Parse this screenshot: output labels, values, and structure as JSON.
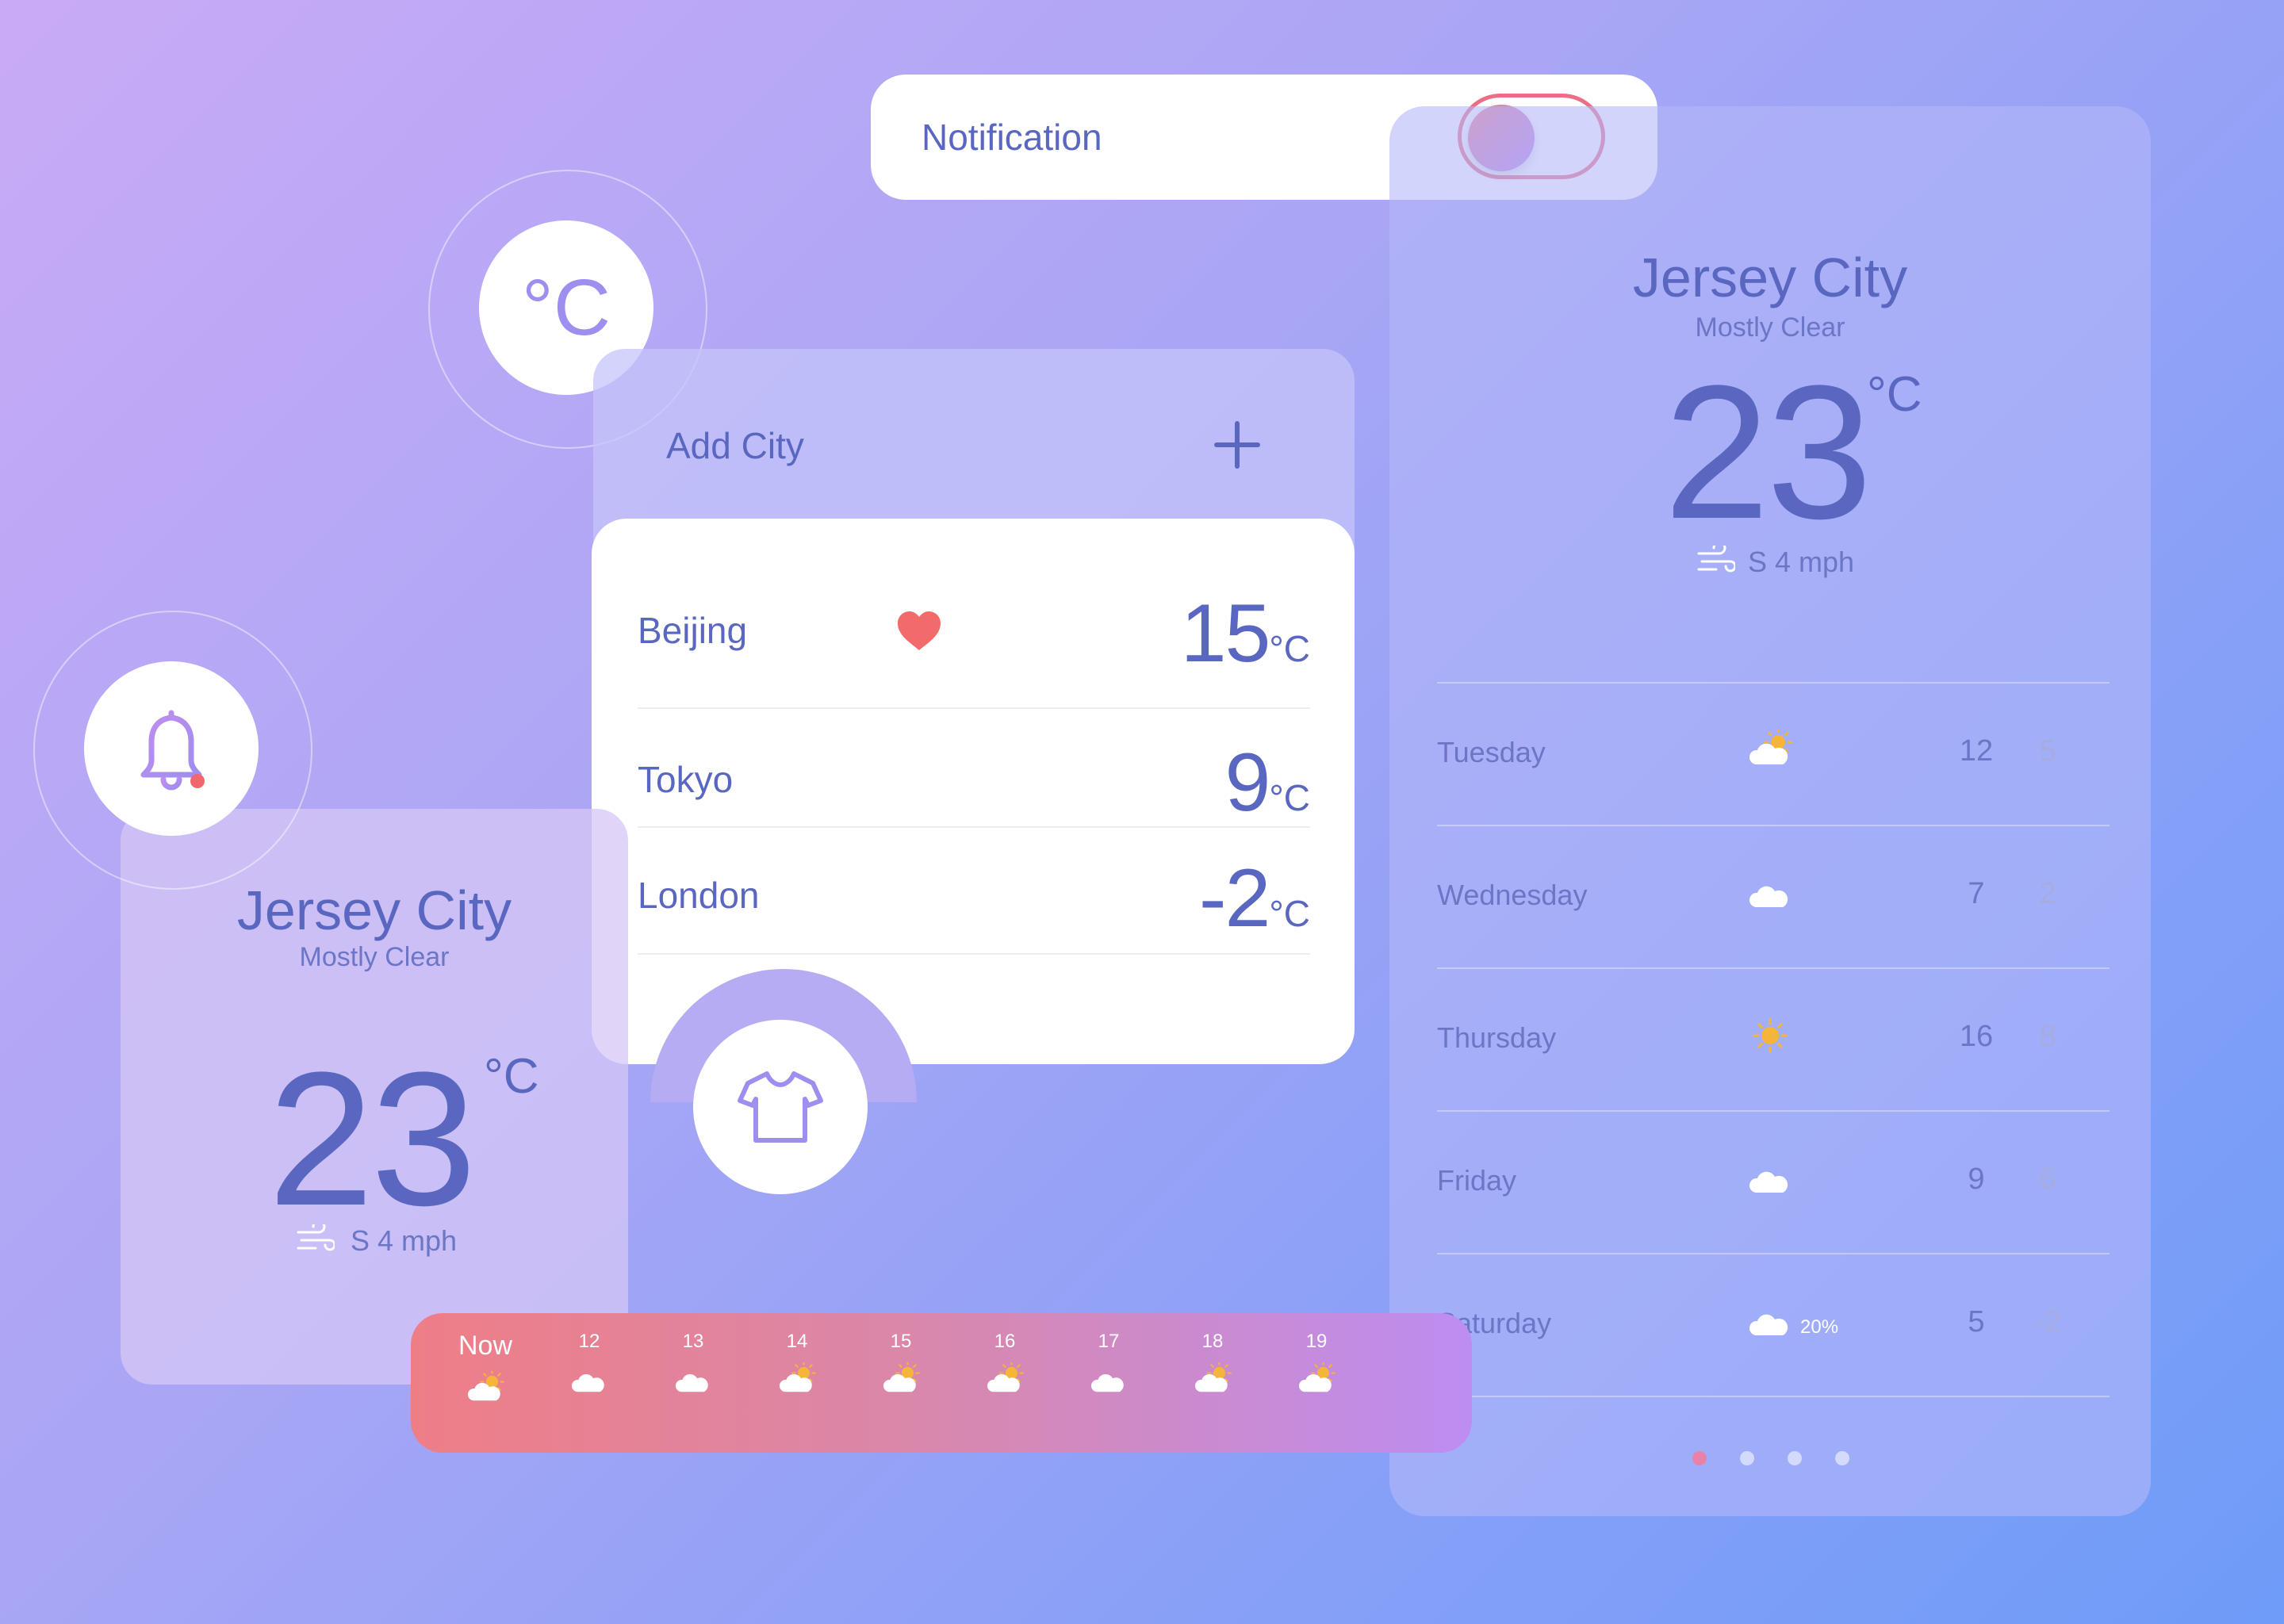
{
  "notification": {
    "label": "Notification",
    "enabled": true
  },
  "unit_button": {
    "label": "°C"
  },
  "add_city": {
    "label": "Add City",
    "plus_icon": "plus-icon"
  },
  "cities": [
    {
      "name": "Beijing",
      "temp": "15",
      "unit": "°C",
      "favorite": true
    },
    {
      "name": "Tokyo",
      "temp": "9",
      "unit": "°C",
      "favorite": false
    },
    {
      "name": "London",
      "temp": "-2",
      "unit": "°C",
      "favorite": false
    }
  ],
  "left_card": {
    "city": "Jersey City",
    "condition": "Mostly Clear",
    "temp": "23",
    "unit": "°C",
    "wind": "S 4 mph"
  },
  "hourly": [
    {
      "label": "Now",
      "icon": "partly-cloudy-icon"
    },
    {
      "label": "12",
      "icon": "cloud-icon"
    },
    {
      "label": "13",
      "icon": "cloud-icon"
    },
    {
      "label": "14",
      "icon": "partly-cloudy-icon"
    },
    {
      "label": "15",
      "icon": "partly-cloudy-icon"
    },
    {
      "label": "16",
      "icon": "partly-cloudy-icon"
    },
    {
      "label": "17",
      "icon": "cloud-icon"
    },
    {
      "label": "18",
      "icon": "partly-cloudy-icon"
    },
    {
      "label": "19",
      "icon": "partly-cloudy-icon"
    }
  ],
  "right_card": {
    "city": "Jersey City",
    "condition": "Mostly Clear",
    "temp": "23",
    "unit": "°C",
    "wind": "S 4 mph",
    "days": [
      {
        "day": "Tuesday",
        "icon": "partly-cloudy-icon",
        "precip": "",
        "high": "12",
        "low": "5"
      },
      {
        "day": "Wednesday",
        "icon": "cloud-icon",
        "precip": "",
        "high": "7",
        "low": "2"
      },
      {
        "day": "Thursday",
        "icon": "sun-icon",
        "precip": "",
        "high": "16",
        "low": "8"
      },
      {
        "day": "Friday",
        "icon": "cloud-icon",
        "precip": "",
        "high": "9",
        "low": "6"
      },
      {
        "day": "Saturday",
        "icon": "cloud-icon",
        "precip": "20%",
        "high": "5",
        "low": "-2"
      }
    ],
    "page_count": 4,
    "active_page": 1
  },
  "colors": {
    "accent": "#5a67c0",
    "heart": "#f26b6b",
    "sun": "#f5b43a",
    "active_dot": "#e882a8"
  }
}
